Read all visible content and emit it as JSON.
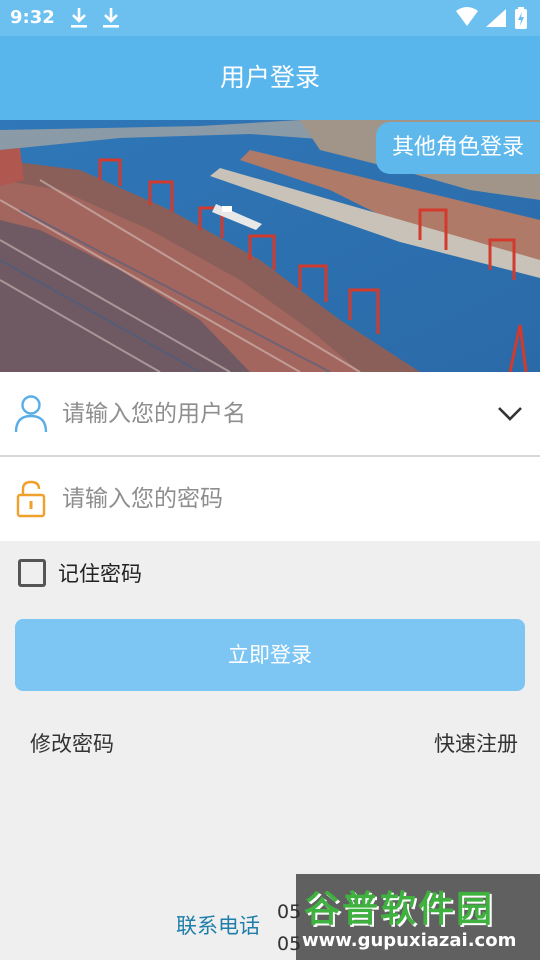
{
  "status_bar": {
    "time": "9:32",
    "icons": [
      "download-icon",
      "download-icon",
      "wifi-icon",
      "cellular-signal-icon",
      "battery-icon"
    ]
  },
  "header": {
    "title": "用户登录"
  },
  "banner": {
    "other_role_button": "其他角色登录"
  },
  "form": {
    "username": {
      "placeholder": "请输入您的用户名",
      "value": "",
      "icon": "user-icon"
    },
    "password": {
      "placeholder": "请输入您的密码",
      "value": "",
      "icon": "lock-icon"
    },
    "remember_label": "记住密码",
    "login_button": "立即登录"
  },
  "links": {
    "change_password": "修改密码",
    "quick_register": "快速注册"
  },
  "contact": {
    "label": "联系电话",
    "number_1": "05",
    "number_2": "05"
  },
  "watermark": {
    "title": "谷普软件园",
    "url": "www.gupuxiazai.com"
  },
  "colors": {
    "header": "#59b6ec",
    "status_bar": "#6cc0f0",
    "login_button": "#7dc5f3",
    "user_icon": "#5aaee8",
    "lock_icon": "#f0a12c",
    "contact": "#1f7fa8"
  }
}
